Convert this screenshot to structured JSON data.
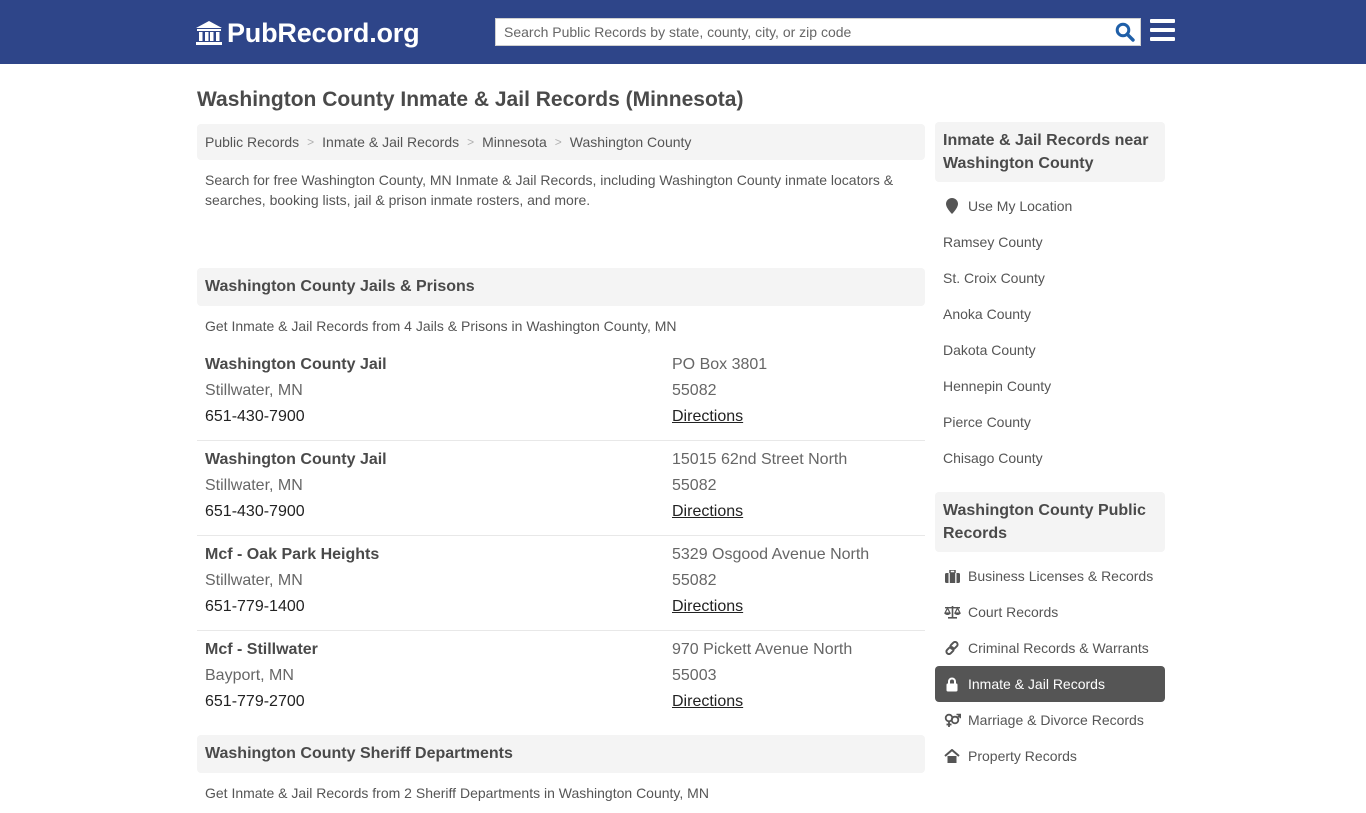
{
  "header": {
    "logo_text": "PubRecord.org",
    "logo_icon": "courthouse-icon",
    "search_placeholder": "Search Public Records by state, county, city, or zip code",
    "search_value": "",
    "search_icon": "search-icon",
    "menu_icon": "hamburger-menu-icon",
    "brand_color": "#2e4589"
  },
  "page": {
    "title": "Washington County Inmate & Jail Records (Minnesota)",
    "breadcrumb": [
      {
        "label": "Public Records"
      },
      {
        "label": "Inmate & Jail Records"
      },
      {
        "label": "Minnesota"
      },
      {
        "label": "Washington County"
      }
    ],
    "breadcrumb_separator": ">",
    "intro": "Search for free Washington County, MN Inmate & Jail Records, including Washington County inmate locators & searches, booking lists, jail & prison inmate rosters, and more."
  },
  "sections": [
    {
      "title": "Washington County Jails & Prisons",
      "subtitle": "Get Inmate & Jail Records from 4 Jails & Prisons in Washington County, MN",
      "entries": [
        {
          "name": "Washington County Jail",
          "city": "Stillwater, MN",
          "phone": "651-430-7900",
          "address": "PO Box 3801",
          "zip": "55082",
          "link": "Directions"
        },
        {
          "name": "Washington County Jail",
          "city": "Stillwater, MN",
          "phone": "651-430-7900",
          "address": "15015 62nd Street North",
          "zip": "55082",
          "link": "Directions"
        },
        {
          "name": "Mcf - Oak Park Heights",
          "city": "Stillwater, MN",
          "phone": "651-779-1400",
          "address": "5329 Osgood Avenue North",
          "zip": "55082",
          "link": "Directions"
        },
        {
          "name": "Mcf - Stillwater",
          "city": "Bayport, MN",
          "phone": "651-779-2700",
          "address": "970 Pickett Avenue North",
          "zip": "55003",
          "link": "Directions"
        }
      ]
    },
    {
      "title": "Washington County Sheriff Departments",
      "subtitle": "Get Inmate & Jail Records from 2 Sheriff Departments in Washington County, MN"
    }
  ],
  "sidebar": {
    "nearby": {
      "title": "Inmate & Jail Records near Washington County",
      "items": [
        {
          "label": "Use My Location",
          "icon": "map-marker-icon"
        },
        {
          "label": "Ramsey County"
        },
        {
          "label": "St. Croix County"
        },
        {
          "label": "Anoka County"
        },
        {
          "label": "Dakota County"
        },
        {
          "label": "Hennepin County"
        },
        {
          "label": "Pierce County"
        },
        {
          "label": "Chisago County"
        }
      ]
    },
    "county_records": {
      "title": "Washington County Public Records",
      "items": [
        {
          "label": "Business Licenses & Records",
          "icon": "briefcase-icon",
          "active": false
        },
        {
          "label": "Court Records",
          "icon": "scales-icon",
          "active": false
        },
        {
          "label": "Criminal Records & Warrants",
          "icon": "link-icon",
          "active": false
        },
        {
          "label": "Inmate & Jail Records",
          "icon": "lock-icon",
          "active": true
        },
        {
          "label": "Marriage & Divorce Records",
          "icon": "gender-symbols-icon",
          "active": false
        },
        {
          "label": "Property Records",
          "icon": "home-icon",
          "active": false
        }
      ],
      "active_color": "#555555"
    }
  }
}
